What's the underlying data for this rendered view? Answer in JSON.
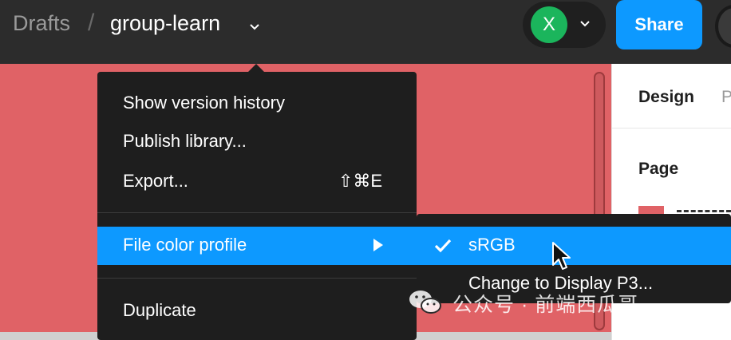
{
  "header": {
    "breadcrumb_root": "Drafts",
    "breadcrumb_sep": "/",
    "file_name": "group-learn",
    "avatar_initial": "X",
    "share_label": "Share"
  },
  "right_panel": {
    "tab_design": "Design",
    "tab_prototype": "P",
    "page_label": "Page"
  },
  "menu": {
    "items": [
      {
        "label": "Show version history"
      },
      {
        "label": "Publish library..."
      },
      {
        "label": "Export...",
        "shortcut": "⇧⌘E"
      },
      {
        "label": "File color profile",
        "has_submenu": true,
        "highlighted": true
      },
      {
        "label": "Duplicate"
      }
    ]
  },
  "submenu": {
    "items": [
      {
        "label": "sRGB",
        "checked": true,
        "highlighted": true
      },
      {
        "label": "Change to Display P3..."
      }
    ]
  },
  "watermark": {
    "text": "公众号 · 前端西瓜哥",
    "icon": "wechat-icon"
  },
  "colors": {
    "topbar": "#2c2c2c",
    "canvas": "#e06266",
    "accent": "#0d99ff",
    "avatar": "#1bb55c",
    "menu_bg": "#1e1e1e"
  }
}
